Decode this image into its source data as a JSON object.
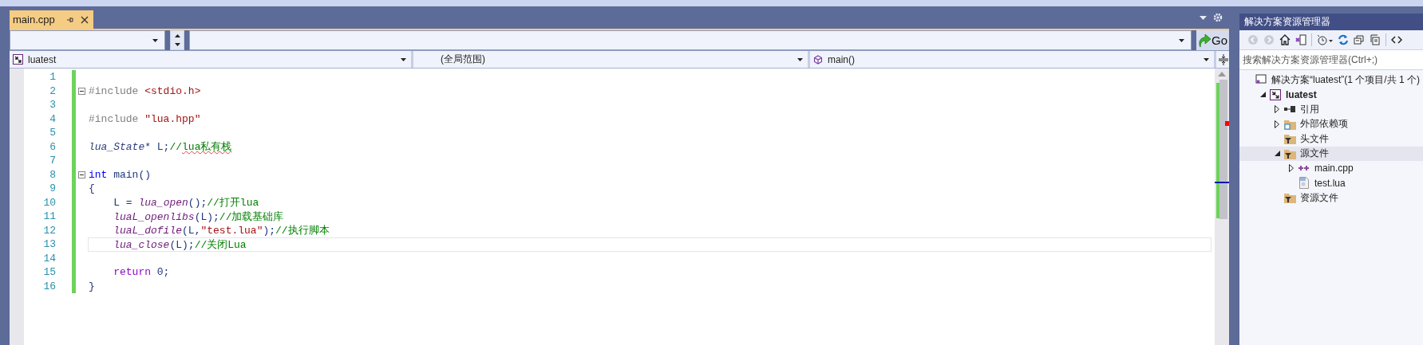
{
  "tab": {
    "label": "main.cpp",
    "selected": true
  },
  "toolbar": {
    "go_label": "Go"
  },
  "nav": {
    "project": "luatest",
    "scope": "(全局范围)",
    "member": "main()"
  },
  "code_lines": [
    {
      "number": "1",
      "fold": false,
      "current": false
    },
    {
      "number": "2",
      "fold": true,
      "current": false,
      "tokens": [
        {
          "text": "#include ",
          "kind": "pre"
        },
        {
          "text": "<stdio.h>",
          "kind": "include"
        }
      ]
    },
    {
      "number": "3",
      "fold": false,
      "current": false
    },
    {
      "number": "4",
      "fold": false,
      "current": false,
      "tokens": [
        {
          "text": "#include ",
          "kind": "pre"
        },
        {
          "text": "\"lua.hpp\"",
          "kind": "include"
        }
      ]
    },
    {
      "number": "5",
      "fold": false,
      "current": false
    },
    {
      "number": "6",
      "fold": false,
      "current": false,
      "tokens": [
        {
          "text": "lua_State",
          "kind": "type"
        },
        {
          "text": "* L;",
          "kind": "plain"
        },
        {
          "text": "//",
          "kind": "comment"
        },
        {
          "text": "lua私有栈",
          "kind": "comment",
          "squiggle": true
        }
      ]
    },
    {
      "number": "7",
      "fold": false,
      "current": false
    },
    {
      "number": "8",
      "fold": true,
      "current": false,
      "tokens": [
        {
          "text": "int",
          "kind": "keyword"
        },
        {
          "text": " main()",
          "kind": "plain"
        }
      ]
    },
    {
      "number": "9",
      "fold": false,
      "current": false,
      "tokens": [
        {
          "text": "{",
          "kind": "plain"
        }
      ]
    },
    {
      "number": "10",
      "fold": false,
      "current": false,
      "tokens": [
        {
          "text": "    L = ",
          "kind": "plain"
        },
        {
          "text": "lua_open",
          "kind": "func"
        },
        {
          "text": "();",
          "kind": "plain"
        },
        {
          "text": "//打开lua",
          "kind": "comment"
        }
      ]
    },
    {
      "number": "11",
      "fold": false,
      "current": false,
      "tokens": [
        {
          "text": "    luaL_openlibs",
          "kind": "func"
        },
        {
          "text": "(L);",
          "kind": "plain"
        },
        {
          "text": "//加载基础库",
          "kind": "comment"
        }
      ]
    },
    {
      "number": "12",
      "fold": false,
      "current": false,
      "tokens": [
        {
          "text": "    luaL_dofile",
          "kind": "func"
        },
        {
          "text": "(L,",
          "kind": "plain"
        },
        {
          "text": "\"test.lua\"",
          "kind": "string"
        },
        {
          "text": ");",
          "kind": "plain"
        },
        {
          "text": "//执行脚本",
          "kind": "comment"
        }
      ]
    },
    {
      "number": "13",
      "fold": false,
      "current": true,
      "tokens": [
        {
          "text": "    lua_close",
          "kind": "func"
        },
        {
          "text": "(L);",
          "kind": "plain"
        },
        {
          "text": "//关闭Lua",
          "kind": "comment"
        }
      ]
    },
    {
      "number": "14",
      "fold": false,
      "current": false
    },
    {
      "number": "15",
      "fold": false,
      "current": false,
      "tokens": [
        {
          "text": "    return",
          "kind": "control"
        },
        {
          "text": " 0;",
          "kind": "plain"
        }
      ]
    },
    {
      "number": "16",
      "fold": false,
      "current": false,
      "tokens": [
        {
          "text": "}",
          "kind": "plain"
        }
      ]
    }
  ],
  "solution_explorer": {
    "title": "解决方案资源管理器",
    "search": {
      "placeholder": "搜索解决方案资源管理器(Ctrl+;)"
    },
    "tree": [
      {
        "label": "解决方案“luatest”(1 个项目/共 1 个)",
        "kind": "solution",
        "selected": false,
        "children": [
          {
            "label": "luatest",
            "kind": "project",
            "expanded": true,
            "selected": false,
            "children": [
              {
                "label": "引用",
                "kind": "references",
                "expanded": false,
                "selected": false
              },
              {
                "label": "外部依赖项",
                "kind": "external",
                "expanded": false,
                "selected": false
              },
              {
                "label": "头文件",
                "kind": "filter",
                "selected": false
              },
              {
                "label": "源文件",
                "kind": "filter",
                "expanded": true,
                "selected": true,
                "children": [
                  {
                    "label": "main.cpp",
                    "kind": "cpp",
                    "expanded": false,
                    "selected": false
                  },
                  {
                    "label": "test.lua",
                    "kind": "lua",
                    "selected": false
                  }
                ]
              },
              {
                "label": "资源文件",
                "kind": "filter",
                "selected": false
              }
            ]
          }
        ]
      }
    ]
  }
}
